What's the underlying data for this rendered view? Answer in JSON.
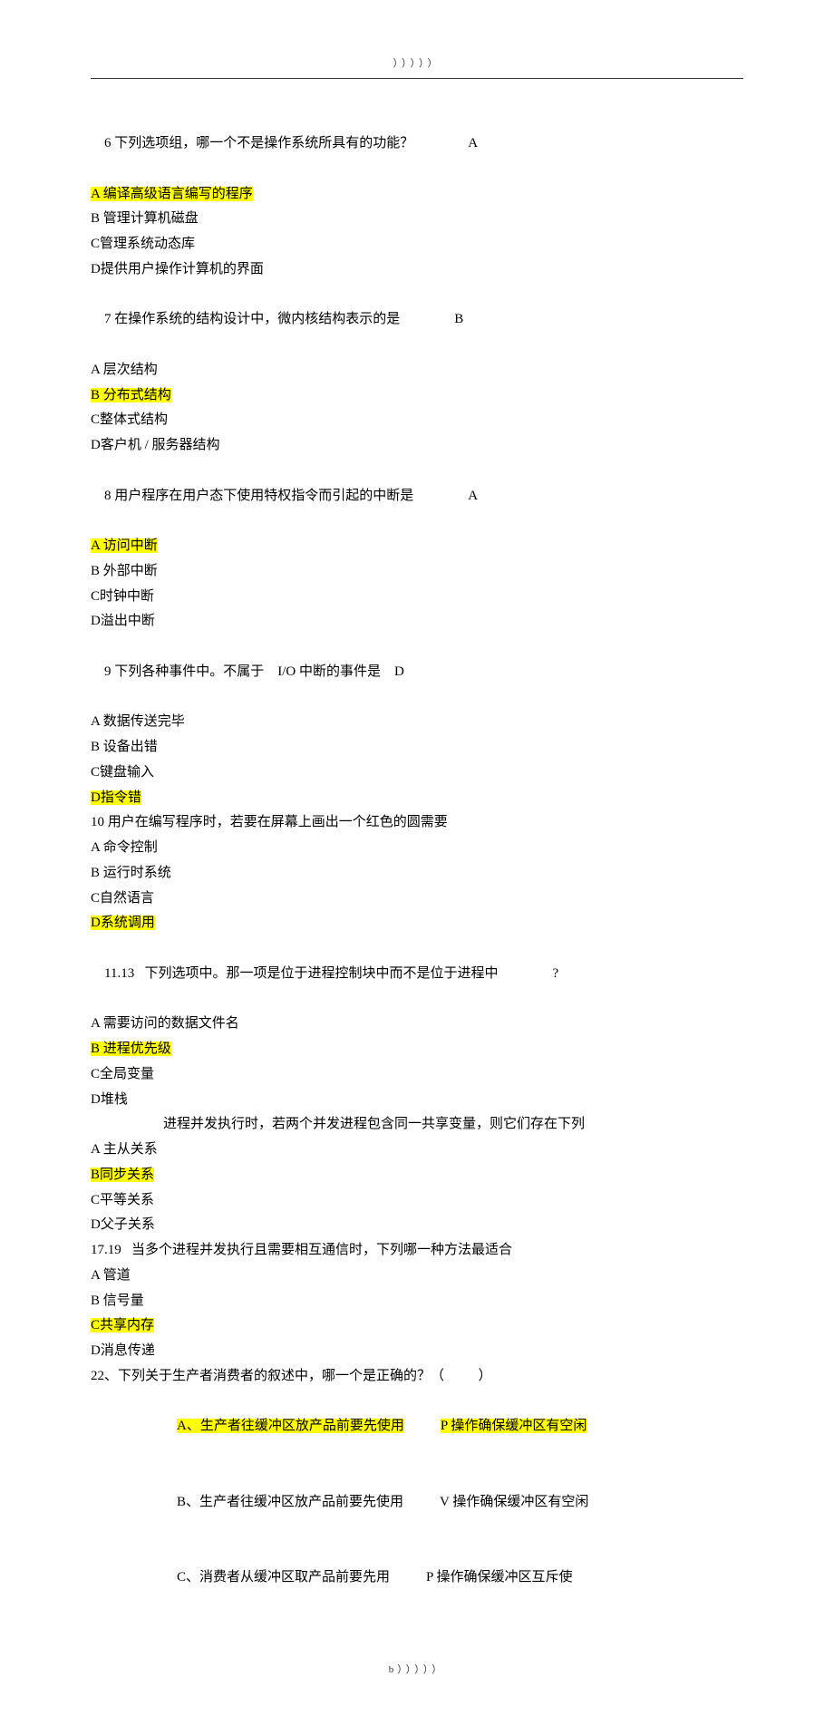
{
  "header_deco": "）））））",
  "q6": {
    "stem_a": "6 下列选项组，哪一个不是操作系统所具有的功能？",
    "ans": "A",
    "optA": "A 编译高级语言编写的程序",
    "optB": "B 管理计算机磁盘",
    "optC": "C管理系统动态库",
    "optD": "D提供用户操作计算机的界面"
  },
  "q7": {
    "stem_a": "7 在操作系统的结构设计中，微内核结构表示的是",
    "ans": "B",
    "optA": "A 层次结构",
    "optB": "B 分布式结构",
    "optC": "C整体式结构",
    "optD": "D客户机 / 服务器结构"
  },
  "q8": {
    "stem_a": "8 用户程序在用户态下使用特权指令而引起的中断是",
    "ans": "A",
    "optA": "A 访问中断",
    "optB": "B 外部中断",
    "optC": "C时钟中断",
    "optD": "D溢出中断"
  },
  "q9": {
    "stem_a": "9 下列各种事件中。不属于",
    "stem_b": "I/O 中断的事件是",
    "ans": "D",
    "optA": "A 数据传送完毕",
    "optB": "B 设备出错",
    "optC": "C键盘输入",
    "optD": "D指令错"
  },
  "q10": {
    "stem": "10 用户在编写程序时，若要在屏幕上画出一个红色的圆需要",
    "optA": "A 命令控制",
    "optB": "B 运行时系统",
    "optC": "C自然语言",
    "optD": "D系统调用"
  },
  "q11": {
    "stem_a": "11.13   下列选项中。那一项是位于进程控制块中而不是位于进程中",
    "ans": "?",
    "optA": "A 需要访问的数据文件名",
    "optB": "B 进程优先级",
    "optC": "C全局变量",
    "optD": "D堆栈"
  },
  "q_share": {
    "stem": "进程并发执行时，若两个并发进程包含同一共享变量，则它们存在下列",
    "optA": "A 主从关系",
    "optB": "B同步关系",
    "optC": "C平等关系",
    "optD": "D父子关系"
  },
  "q17": {
    "stem": "17.19   当多个进程并发执行且需要相互通信时，下列哪一种方法最适合",
    "optA": "A 管道",
    "optB": "B 信号量",
    "optC": "C共享内存",
    "optD": "D消息传递"
  },
  "q22": {
    "stem": "22、下列关于生产者消费者的叙述中，哪一个是正确的？（          ）",
    "optA_a": "A、生产者往缓冲区放产品前要先使用",
    "optA_b": "P 操作确保缓冲区有空闲",
    "optB_a": "B、生产者往缓冲区放产品前要先使用",
    "optB_b": "V 操作确保缓冲区有空闲",
    "optC_a": "C、消费者从缓冲区取产品前要先用",
    "optC_b": "P 操作确保缓冲区互斥使"
  },
  "footer_deco": "b）））））"
}
